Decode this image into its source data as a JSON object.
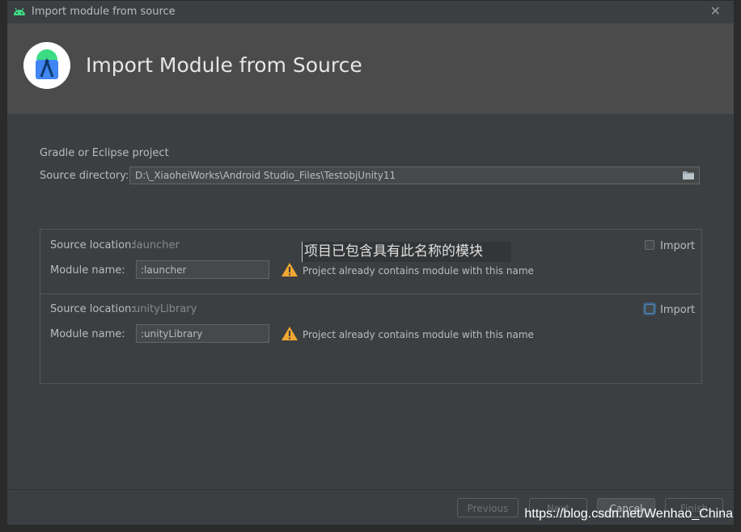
{
  "window": {
    "title": "Import module from source"
  },
  "header": {
    "title": "Import Module from Source"
  },
  "form": {
    "section_label": "Gradle or Eclipse project",
    "source_dir_label": "Source directory:",
    "source_dir_value": "D:\\_XiaoheiWorks\\Android Studio_Files\\TestobjUnity11"
  },
  "modules": [
    {
      "location_label": "Source location:",
      "location_value": "launcher",
      "name_label": "Module name:",
      "name_value": ":launcher",
      "warning": "Project already contains module with this name",
      "import_label": "Import"
    },
    {
      "location_label": "Source location:",
      "location_value": "unityLibrary",
      "name_label": "Module name:",
      "name_value": ":unityLibrary",
      "warning": "Project already contains module with this name",
      "import_label": "Import"
    }
  ],
  "tooltip": "项目已包含具有此名称的模块",
  "buttons": {
    "previous": "Previous",
    "next": "Next",
    "cancel": "Cancel",
    "finish": "Finish"
  },
  "watermark": "https://blog.csdn.net/Wenhao_China",
  "colors": {
    "warning": "#f0a732",
    "android_green": "#3ddc84",
    "focus": "#3d6185"
  }
}
